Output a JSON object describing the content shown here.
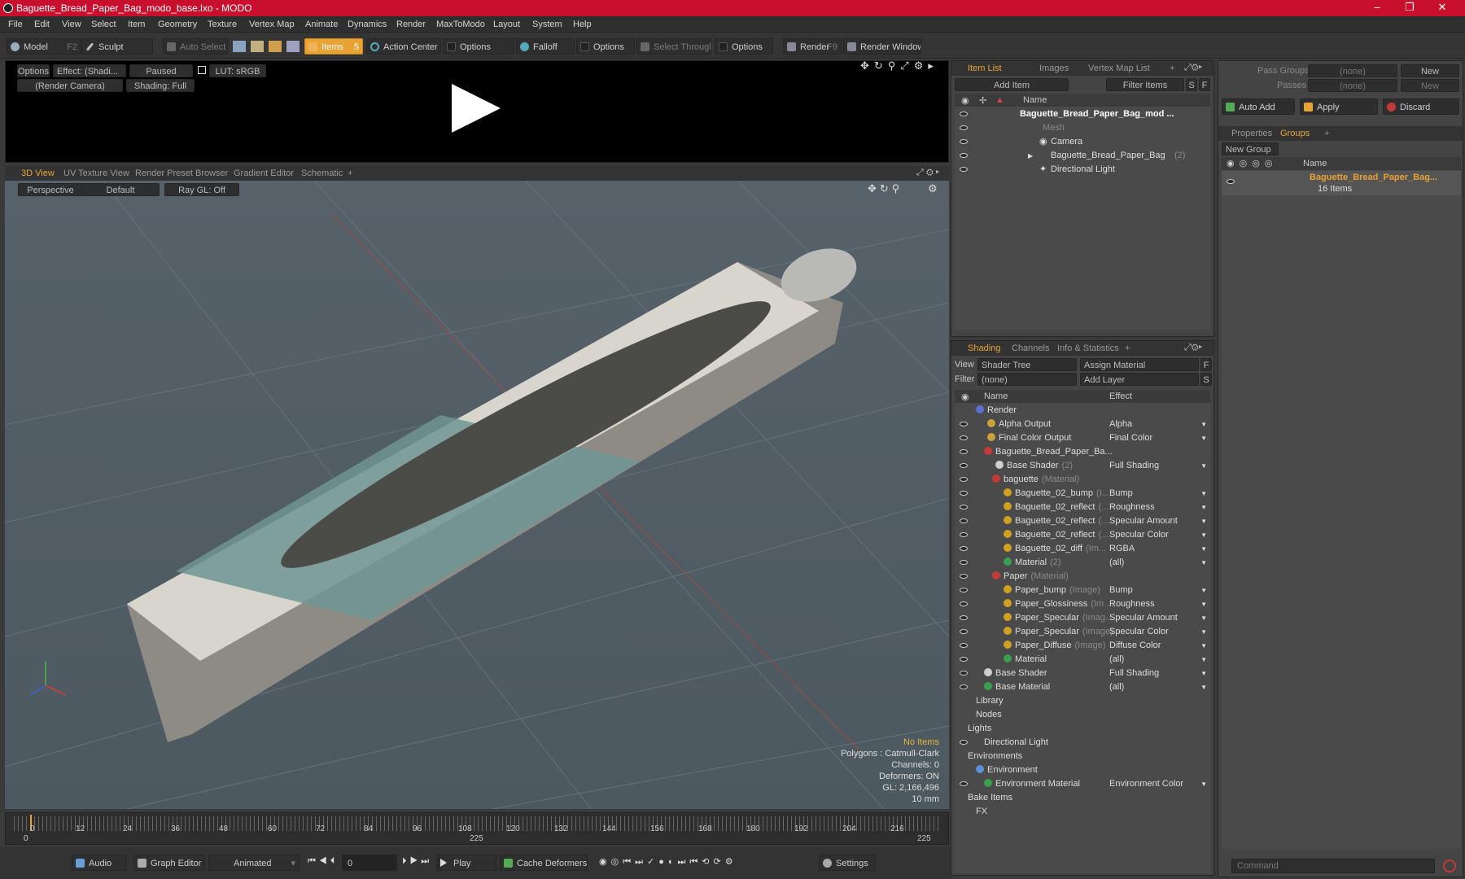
{
  "window": {
    "title": "Baguette_Bread_Paper_Bag_modo_base.lxo - MODO",
    "minimize": "–",
    "maximize": "❐",
    "close": "✕"
  },
  "menu": [
    "File",
    "Edit",
    "View",
    "Select",
    "Item",
    "Geometry",
    "Texture",
    "Vertex Map",
    "Animate",
    "Dynamics",
    "Render",
    "MaxToModo",
    "Layout",
    "System",
    "Help"
  ],
  "toolbar": {
    "model": "Model",
    "model_key": "F2",
    "sculpt": "Sculpt",
    "auto_select": "Auto Select",
    "items": "Items",
    "items_key": "5",
    "action_center": "Action Center",
    "options1": "Options",
    "falloff": "Falloff",
    "options2": "Options",
    "select_through": "Select Through",
    "options3": "Options",
    "render": "Render",
    "render_key": "F9",
    "render_window": "Render Window"
  },
  "preview": {
    "options": "Options",
    "effect": "Effect: (Shadi...",
    "paused": "Paused",
    "lut": "LUT: sRGB",
    "camera": "(Render Camera)",
    "shading": "Shading: Full"
  },
  "viewtabs": [
    "3D View",
    "UV Texture View",
    "Render Preset Browser",
    "Gradient Editor",
    "Schematic",
    "+"
  ],
  "viewport": {
    "perspective": "Perspective",
    "default": "Default",
    "raygl": "Ray GL: Off",
    "stats": [
      "No Items",
      "Polygons : Catmull-Clark",
      "Channels: 0",
      "Deformers: ON",
      "GL: 2,166,496",
      "10 mm"
    ]
  },
  "timeline": {
    "ticks": [
      "0",
      "12",
      "24",
      "36",
      "48",
      "60",
      "72",
      "84",
      "96",
      "108",
      "120",
      "132",
      "144",
      "156",
      "168",
      "180",
      "192",
      "204",
      "216"
    ],
    "start": "0",
    "mid": "225",
    "end": "225"
  },
  "transport": {
    "audio": "Audio",
    "graph": "Graph Editor",
    "animated": "Animated",
    "frame": "0",
    "play": "Play",
    "cache": "Cache Deformers",
    "settings": "Settings"
  },
  "itemlist": {
    "tabs": [
      "Item List",
      "Images",
      "Vertex Map List",
      "+"
    ],
    "add_item": "Add Item",
    "filter": "Filter Items",
    "s": "S",
    "f": "F",
    "col_name": "Name",
    "rows": [
      {
        "label": "Baguette_Bread_Paper_Bag_mod ...",
        "bold": true
      },
      {
        "label": "Mesh",
        "gray": true
      },
      {
        "label": "Camera"
      },
      {
        "label": "Baguette_Bread_Paper_Bag",
        "suffix": "(2)"
      },
      {
        "label": "Directional Light"
      }
    ]
  },
  "shading": {
    "tabs": [
      "Shading",
      "Channels",
      "Info & Statistics",
      "+"
    ],
    "view_label": "View",
    "view_value": "Shader Tree",
    "assign": "Assign Material",
    "f": "F",
    "filter_label": "Filter",
    "filter_value": "(none)",
    "add_layer": "Add Layer",
    "s": "S",
    "col_name": "Name",
    "col_effect": "Effect",
    "rows": [
      {
        "label": "Render",
        "effect": "",
        "ball": "#5b6fd6"
      },
      {
        "label": "Alpha Output",
        "effect": "Alpha",
        "ball": "#c9a23a"
      },
      {
        "label": "Final Color Output",
        "effect": "Final Color",
        "ball": "#c9a23a"
      },
      {
        "label": "Baguette_Bread_Paper_Ba...",
        "effect": "",
        "ball": "#c43a3a"
      },
      {
        "label": "Base Shader",
        "suffix": "(2)",
        "effect": "Full Shading",
        "ball": "#d0d0d0"
      },
      {
        "label": "baguette",
        "suffix": "(Material)",
        "effect": "",
        "ball": "#c43a3a"
      },
      {
        "label": "Baguette_02_bump",
        "suffix": "(I...",
        "effect": "Bump",
        "ball": "#d0a020"
      },
      {
        "label": "Baguette_02_reflect",
        "suffix": "(...",
        "effect": "Roughness",
        "ball": "#d0a020"
      },
      {
        "label": "Baguette_02_reflect",
        "suffix": "(...",
        "effect": "Specular Amount",
        "ball": "#d0a020"
      },
      {
        "label": "Baguette_02_reflect",
        "suffix": "(...",
        "effect": "Specular Color",
        "ball": "#d0a020"
      },
      {
        "label": "Baguette_02_diff",
        "suffix": "(Im...",
        "effect": "RGBA",
        "ball": "#d0a020"
      },
      {
        "label": "Material",
        "suffix": "(2)",
        "effect": "(all)",
        "ball": "#3aa050"
      },
      {
        "label": "Paper",
        "suffix": "(Material)",
        "effect": "",
        "ball": "#c43a3a"
      },
      {
        "label": "Paper_bump",
        "suffix": "(Image)",
        "effect": "Bump",
        "ball": "#d0a020"
      },
      {
        "label": "Paper_Glossiness",
        "suffix": "(Im ...",
        "effect": "Roughness",
        "ball": "#d0a020"
      },
      {
        "label": "Paper_Specular",
        "suffix": "(Imag...",
        "effect": "Specular Amount",
        "ball": "#d0a020"
      },
      {
        "label": "Paper_Specular",
        "suffix": "(Image)",
        "effect": "Specular Color",
        "ball": "#d0a020"
      },
      {
        "label": "Paper_Diffuse",
        "suffix": "(Image)",
        "effect": "Diffuse Color",
        "ball": "#d0a020"
      },
      {
        "label": "Material",
        "effect": "(all)",
        "ball": "#3aa050"
      },
      {
        "label": "Base Shader",
        "effect": "Full Shading",
        "ball": "#d0d0d0"
      },
      {
        "label": "Base Material",
        "effect": "(all)",
        "ball": "#3aa050"
      },
      {
        "label": "Library",
        "effect": ""
      },
      {
        "label": "Nodes",
        "effect": ""
      },
      {
        "label": "Lights",
        "effect": ""
      },
      {
        "label": "Directional Light",
        "effect": ""
      },
      {
        "label": "Environments",
        "effect": ""
      },
      {
        "label": "Environment",
        "effect": "",
        "ball": "#5b8fd6"
      },
      {
        "label": "Environment Material",
        "effect": "Environment Color",
        "ball": "#3aa050"
      },
      {
        "label": "Bake Items",
        "effect": ""
      },
      {
        "label": "FX",
        "effect": ""
      }
    ]
  },
  "right": {
    "pass_groups": "Pass Groups",
    "passes": "Passes",
    "none1": "(none)",
    "none2": "(none)",
    "new1": "New",
    "new2": "New",
    "auto_add": "Auto Add",
    "apply": "Apply",
    "discard": "Discard",
    "tabs": [
      "Properties",
      "Groups",
      "+"
    ],
    "new_group": "New Group",
    "col_name": "Name",
    "group_name": "Baguette_Bread_Paper_Bag...",
    "group_count": "16 Items",
    "command": "Command"
  }
}
